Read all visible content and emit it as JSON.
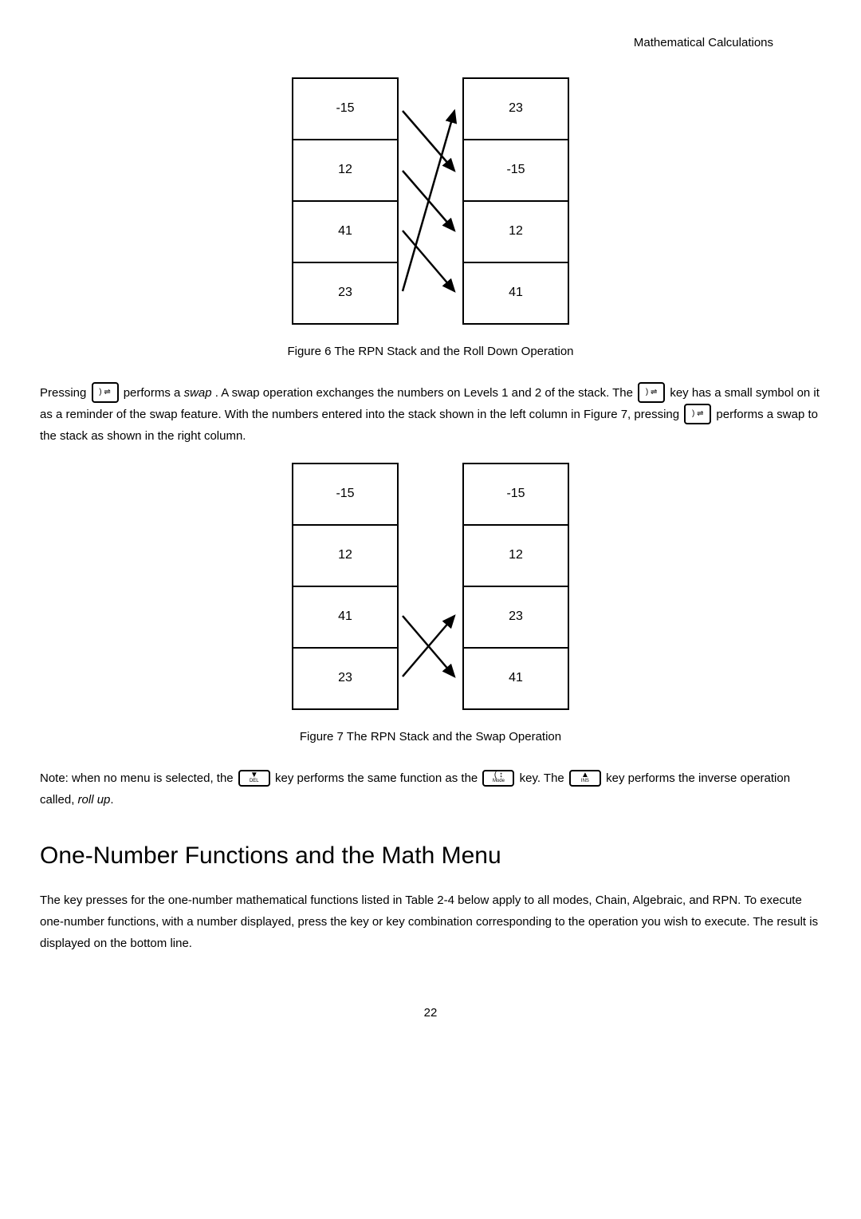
{
  "header": {
    "title": "Mathematical Calculations"
  },
  "figure6": {
    "left": [
      "-15",
      "12",
      "41",
      "23"
    ],
    "right": [
      "23",
      "-15",
      "12",
      "41"
    ],
    "caption": "Figure 6 The RPN Stack and the Roll Down Operation"
  },
  "para1": {
    "t1": "Pressing ",
    "t2": " performs a ",
    "swap": "swap",
    "t3": ". A swap operation exchanges the numbers on Levels 1 and 2 of the stack. The ",
    "t4": " key has a small symbol on it as a reminder of the swap feature. With the numbers entered into the stack shown in the left column in Figure 7, pressing ",
    "t5": " performs a swap to the stack as shown in the right column."
  },
  "figure7": {
    "left": [
      "-15",
      "12",
      "41",
      "23"
    ],
    "right": [
      "-15",
      "12",
      "23",
      "41"
    ],
    "caption": "Figure 7 The RPN Stack and the Swap Operation"
  },
  "para2": {
    "t1": "Note: when no menu is selected, the ",
    "t2": " key performs the same function as the ",
    "t3": " key. The ",
    "t4": " key performs the inverse operation called, ",
    "rollup": "roll up",
    "t5": "."
  },
  "section": {
    "heading": "One-Number Functions and the Math Menu"
  },
  "para3": {
    "text": "The key presses for the one-number mathematical functions listed in Table 2-4 below apply to all modes, Chain, Algebraic, and RPN. To execute one-number functions, with a number displayed, press the key or key combination corresponding to the operation you wish to execute. The result is displayed on the bottom line."
  },
  "pageNumber": "22",
  "keys": {
    "swap": ") ⇌",
    "down_del": {
      "arrow": "▼",
      "label": "DEL"
    },
    "paren_mode": {
      "top": "( ↕",
      "label": "Mode"
    },
    "up_ins": {
      "arrow": "▲",
      "label": "INS"
    }
  }
}
